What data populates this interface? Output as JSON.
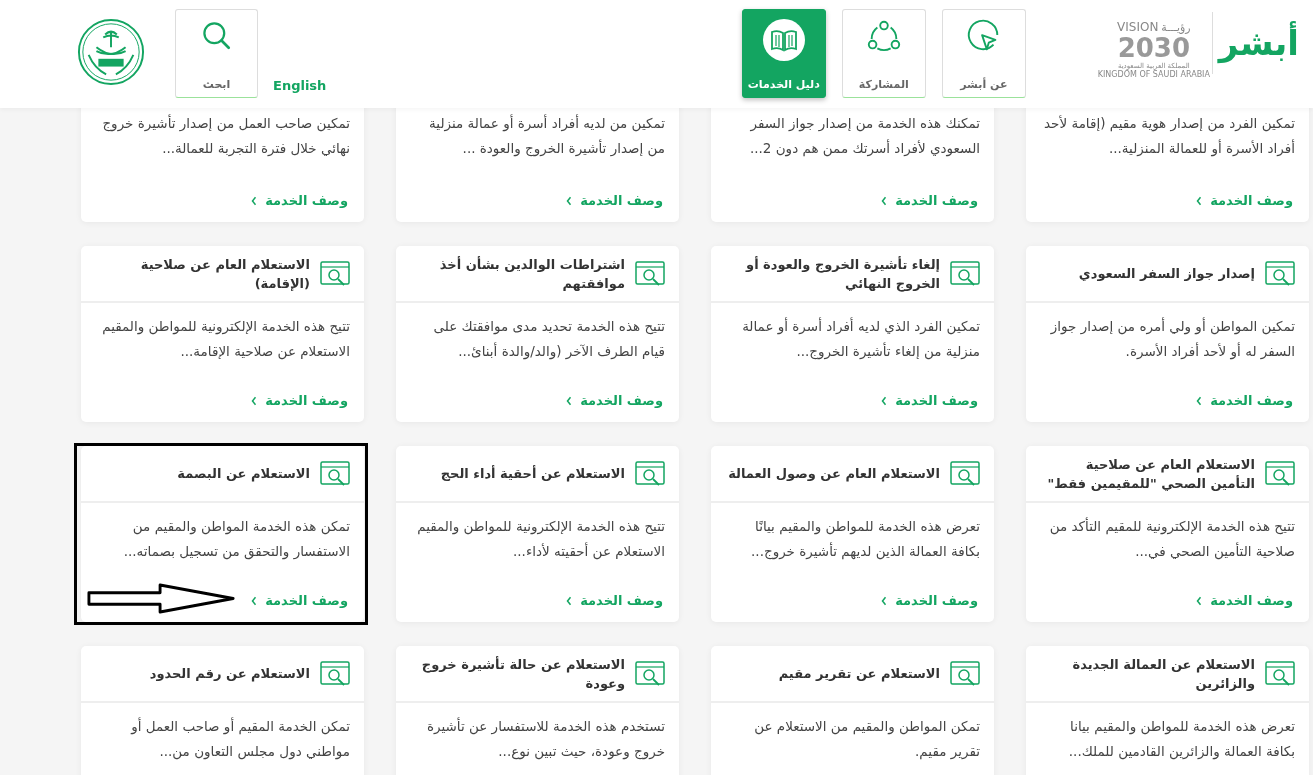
{
  "header": {
    "logo": {
      "text": "أبشر"
    },
    "vision": {
      "word": "VISION",
      "arabic": "رؤيـــة",
      "year": "2030",
      "country_ar": "المملكة العربية السعودية",
      "country_en": "KINGDOM OF SAUDI ARABIA"
    },
    "nav": [
      {
        "label": "عن أبشر",
        "kind": "cursor",
        "selected": false
      },
      {
        "label": "المشاركة",
        "kind": "share",
        "selected": false
      },
      {
        "label": "دليل الخدمات",
        "kind": "book",
        "selected": true
      }
    ],
    "language_link": "English",
    "search": {
      "label": "ابحث"
    }
  },
  "cards": [
    {
      "description": "تمكين الفرد من إصدار هوية مقيم (إقامة لأحد أفراد الأسرة أو للعمالة المنزلية...",
      "link": "وصف الخدمة",
      "highlighted": false
    },
    {
      "description": "تمكنك هذه الخدمة من إصدار جواز السفر السعودي لأفراد أسرتك ممن هم دون 2...",
      "link": "وصف الخدمة",
      "highlighted": false
    },
    {
      "description": "تمكين من لديه أفراد أسرة أو عمالة منزلية من إصدار تأشيرة الخروج والعودة ...",
      "link": "وصف الخدمة",
      "highlighted": false
    },
    {
      "description": "تمكين صاحب العمل من إصدار تأشيرة خروج نهائي خلال فترة التجربة للعمالة...",
      "link": "وصف الخدمة",
      "highlighted": false
    },
    {
      "title": "إصدار جواز السفر السعودي",
      "description": "تمكين المواطن أو ولي أمره من إصدار جواز السفر له أو لأحد أفراد الأسرة.",
      "link": "وصف الخدمة",
      "highlighted": false
    },
    {
      "title": "إلغاء تأشيرة الخروج والعودة أو الخروج النهائي",
      "description": "تمكين الفرد الذي لديه أفراد أسرة أو عمالة منزلية من إلغاء تأشيرة الخروج...",
      "link": "وصف الخدمة",
      "highlighted": false
    },
    {
      "title": "اشتراطات الوالدين بشأن أخذ موافقتهم",
      "description": "تتيح هذه الخدمة تحديد مدى موافقتك على قيام الطرف الآخر (والد/والدة أبنائ...",
      "link": "وصف الخدمة",
      "highlighted": false
    },
    {
      "title": "الاستعلام العام عن صلاحية (الإقامة)",
      "description": "تتيح هذه الخدمة الإلكترونية للمواطن والمقيم الاستعلام عن صلاحية الإقامة...",
      "link": "وصف الخدمة",
      "highlighted": false
    },
    {
      "title": "الاستعلام العام عن صلاحية التأمين الصحي \"للمقيمين فقط\"",
      "description": "تتيح هذه الخدمة الإلكترونية للمقيم التأكد من صلاحية التأمين الصحي في...",
      "link": "وصف الخدمة",
      "highlighted": false
    },
    {
      "title": "الاستعلام العام عن وصول العمالة",
      "description": "تعرض هذه الخدمة للمواطن والمقيم بيانًا بكافة العمالة الذين لديهم تأشيرة خروج...",
      "link": "وصف الخدمة",
      "highlighted": false
    },
    {
      "title": "الاستعلام عن أحقية أداء الحج",
      "description": "تتيح هذه الخدمة الإلكترونية للمواطن والمقيم الاستعلام عن أحقيته لأداء...",
      "link": "وصف الخدمة",
      "highlighted": false
    },
    {
      "title": "الاستعلام عن البصمة",
      "description": "تمكن هذه الخدمة المواطن والمقيم من الاستفسار والتحقق من تسجيل بصماته...",
      "link": "وصف الخدمة",
      "highlighted": true
    },
    {
      "title": "الاستعلام عن العمالة الجديدة والزائرين",
      "description": "تعرض هذه الخدمة للمواطن والمقيم بيانا بكافة العمالة والزائرين القادمين للملك...",
      "highlighted": false
    },
    {
      "title": "الاستعلام عن تقرير مقيم",
      "description": "تمكن المواطن والمقيم من الاستعلام عن تقرير مقيم.",
      "highlighted": false
    },
    {
      "title": "الاستعلام عن حالة تأشيرة خروج وعودة",
      "description": "تستخدم هذه الخدمة للاستفسار عن تأشيرة خروج وعودة، حيث تبين نوع...",
      "highlighted": false
    },
    {
      "title": "الاستعلام عن رقم الحدود",
      "description": "تمكن الخدمة المقيم أو صاحب العمل أو مواطني دول مجلس التعاون من...",
      "highlighted": false
    }
  ]
}
